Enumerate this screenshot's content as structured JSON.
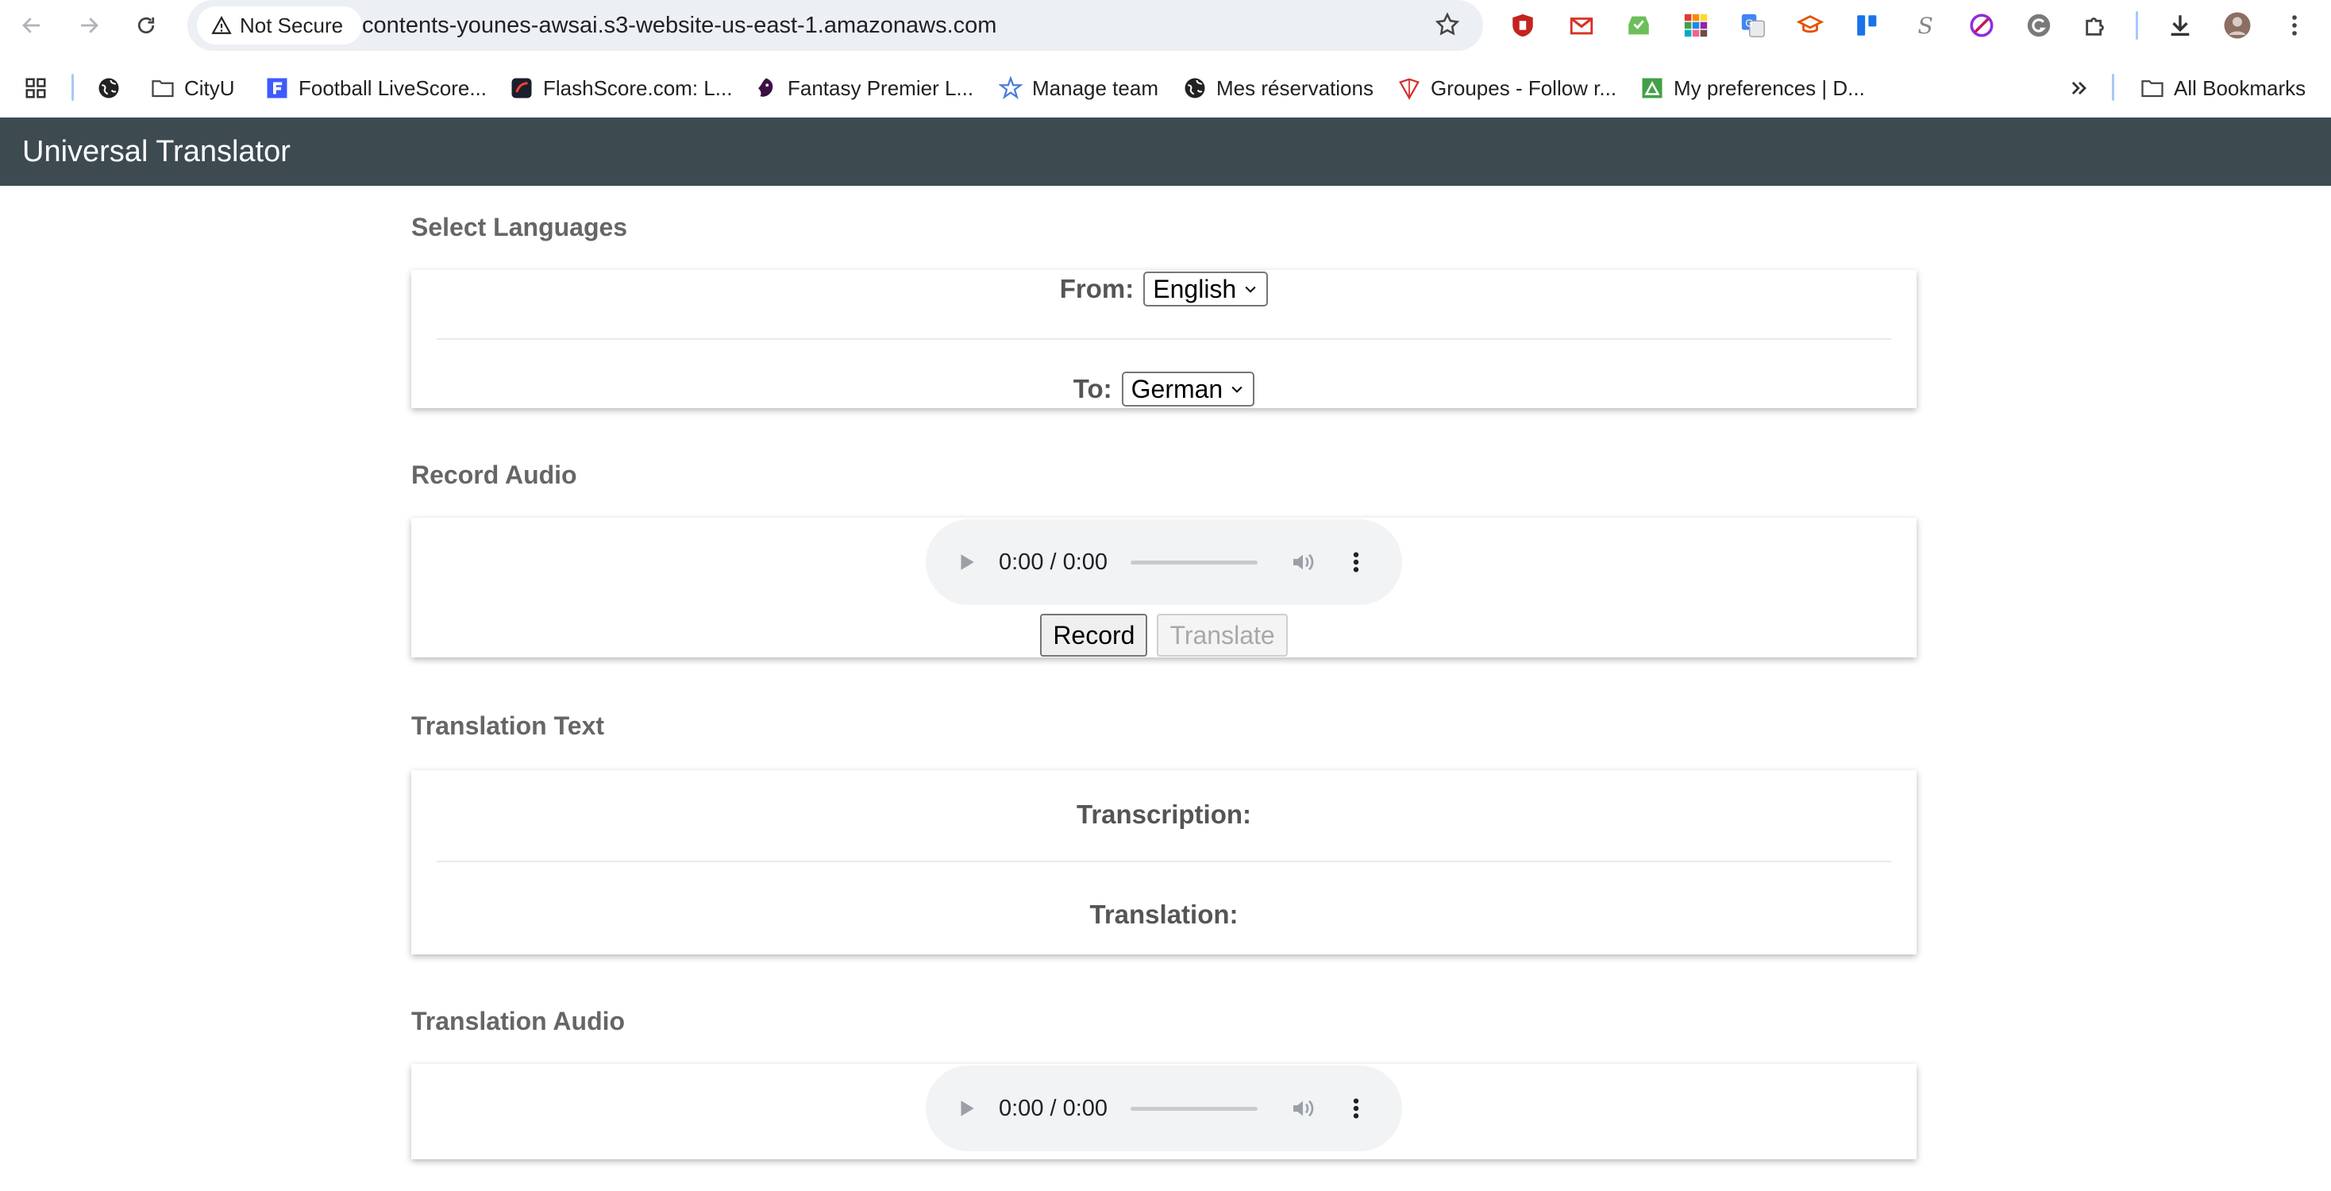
{
  "browser": {
    "security_label": "Not Secure",
    "url": "contents-younes-awsai.s3-website-us-east-1.amazonaws.com",
    "bookmarks": [
      {
        "label": "CityU"
      },
      {
        "label": "Football LiveScore..."
      },
      {
        "label": "FlashScore.com: L..."
      },
      {
        "label": "Fantasy Premier L..."
      },
      {
        "label": "Manage team"
      },
      {
        "label": "Mes réservations"
      },
      {
        "label": "Groupes - Follow r..."
      },
      {
        "label": "My preferences | D..."
      }
    ],
    "all_bookmarks_label": "All Bookmarks"
  },
  "app": {
    "title": "Universal Translator"
  },
  "languages": {
    "heading": "Select Languages",
    "from_label": "From:",
    "from_value": "English",
    "to_label": "To:",
    "to_value": "German"
  },
  "record": {
    "heading": "Record Audio",
    "player_time": "0:00 / 0:00",
    "record_button": "Record",
    "translate_button": "Translate"
  },
  "text": {
    "heading": "Translation Text",
    "transcription_label": "Transcription:",
    "translation_label": "Translation:"
  },
  "output_audio": {
    "heading": "Translation Audio",
    "player_time": "0:00 / 0:00"
  },
  "colors": {
    "header_bg": "#3d4b51",
    "heading_text": "#666666",
    "omnibox_bg": "#eceff3"
  }
}
